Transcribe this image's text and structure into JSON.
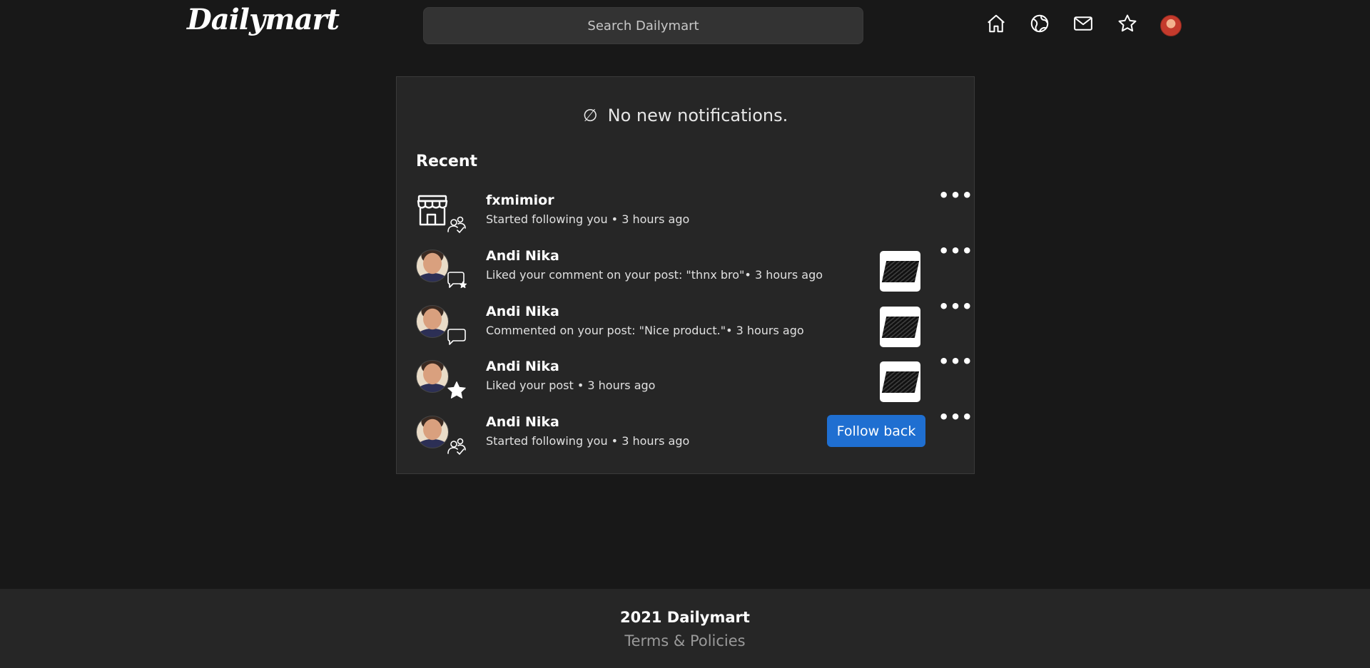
{
  "header": {
    "logo": "Dailymart",
    "search_placeholder": "Search Dailymart",
    "nav": [
      {
        "name": "home",
        "icon": "home-icon"
      },
      {
        "name": "explore",
        "icon": "globe-icon"
      },
      {
        "name": "messages",
        "icon": "mail-icon"
      },
      {
        "name": "favorites",
        "icon": "star-icon"
      },
      {
        "name": "profile",
        "icon": "avatar"
      }
    ]
  },
  "notifications": {
    "empty_glyph": "∅",
    "empty_text": "No new notifications.",
    "section_title": "Recent",
    "items": [
      {
        "name": "fxmimior",
        "text": "Started following you • 3 hours ago",
        "avatar": "store-icon",
        "badge": "followers-icon"
      },
      {
        "name": "Andi Nika",
        "text": "Liked your comment on your post: \"thnx bro\"• 3 hours ago",
        "avatar": "user-photo",
        "badge": "comment-star-icon",
        "thumbnail": "product-thumbnail"
      },
      {
        "name": "Andi Nika",
        "text": "Commented on your post: \"Nice product.\"• 3 hours ago",
        "avatar": "user-photo",
        "badge": "comment-icon",
        "thumbnail": "product-thumbnail"
      },
      {
        "name": "Andi Nika",
        "text": "Liked your post • 3 hours ago",
        "avatar": "user-photo",
        "badge": "star-icon",
        "thumbnail": "product-thumbnail"
      },
      {
        "name": "Andi Nika",
        "text": "Started following you • 3 hours ago",
        "avatar": "user-photo",
        "badge": "followers-icon",
        "action_label": "Follow back"
      }
    ],
    "more_label": "•••"
  },
  "footer": {
    "copyright": "2021 Dailymart",
    "terms": "Terms & Policies"
  },
  "colors": {
    "background": "#181818",
    "card": "#262626",
    "accent": "#1f6fd1",
    "muted": "#9a9a9a"
  }
}
